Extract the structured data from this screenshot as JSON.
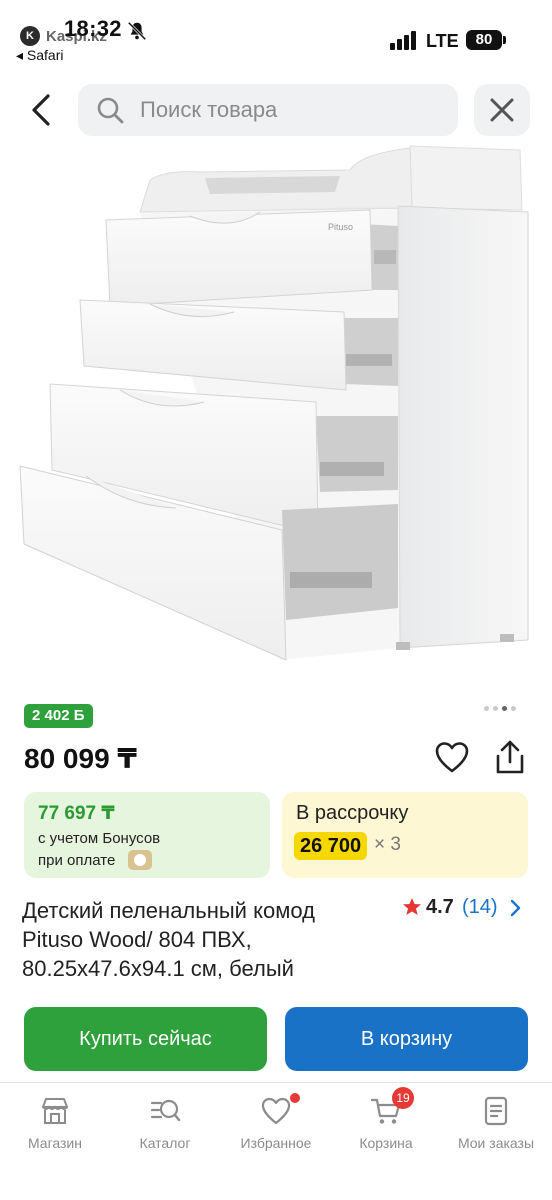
{
  "status_bar": {
    "time": "18:32",
    "source_app": "Kaspi.kz",
    "back_to": "◂ Safari",
    "network": "LTE",
    "battery": "80"
  },
  "search": {
    "placeholder": "Поиск товара"
  },
  "product": {
    "bonus_badge": "2 402 Б",
    "price": "80 099 ₸",
    "bonus_card": {
      "amount": "77 697 ₸",
      "line1": "с учетом Бонусов",
      "line2": "при оплате"
    },
    "installment_card": {
      "title": "В рассрочку",
      "monthly": "26 700",
      "multiplier": "× 3"
    },
    "title": "Детский пеленальный комод Pituso Wood/ 804 ПВХ, 80.25x47.6x94.1 см, белый",
    "rating": "4.7",
    "reviews": "(14)",
    "image_brand": "Pituso",
    "image_pages": 4,
    "image_active_page": 3
  },
  "actions": {
    "buy_now": "Купить сейчас",
    "add_to_cart": "В корзину"
  },
  "tabbar": {
    "items": [
      {
        "label": "Магазин",
        "icon": "shop-icon"
      },
      {
        "label": "Каталог",
        "icon": "catalog-icon"
      },
      {
        "label": "Избранное",
        "icon": "heart-icon"
      },
      {
        "label": "Корзина",
        "icon": "cart-icon",
        "badge": "19"
      },
      {
        "label": "Мои заказы",
        "icon": "orders-icon"
      }
    ]
  },
  "colors": {
    "green": "#2fa13c",
    "blue": "#1a72c6",
    "yellow": "#f6d800",
    "link": "#1a73c7",
    "red": "#e53935"
  }
}
